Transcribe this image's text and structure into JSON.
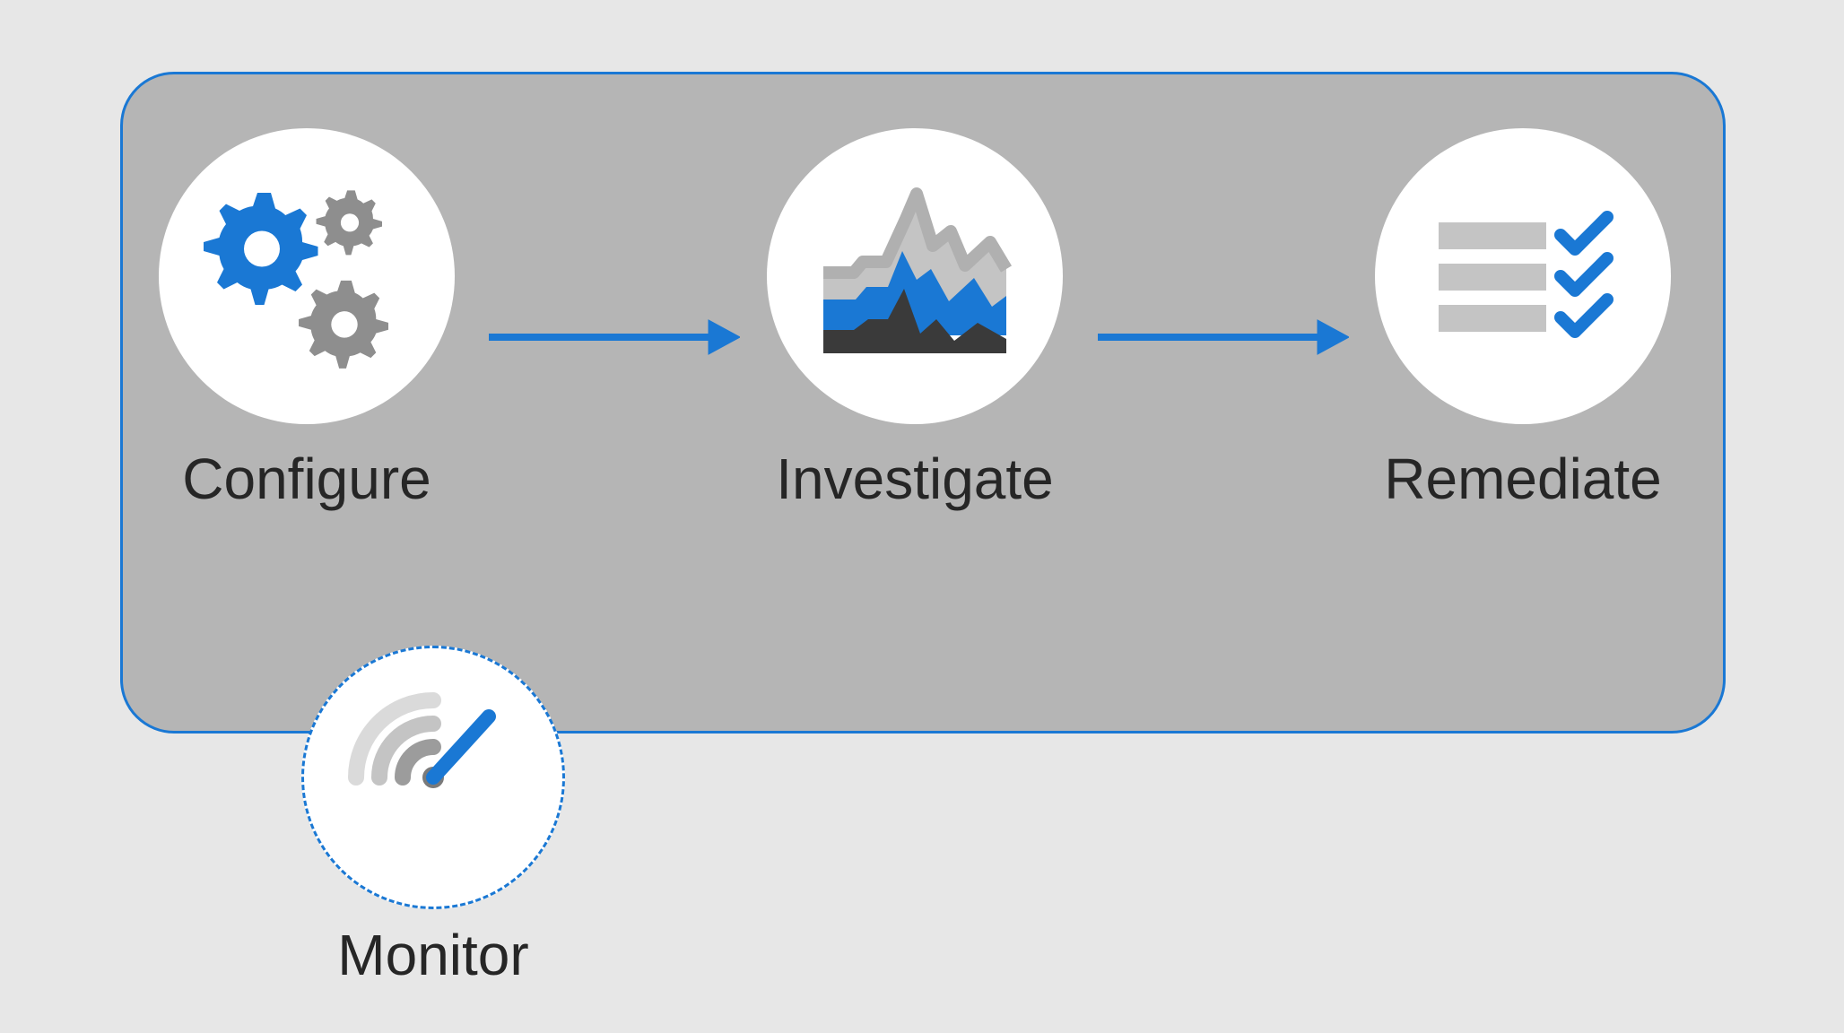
{
  "steps": [
    {
      "label": "Configure",
      "icon": "gears-icon"
    },
    {
      "label": "Investigate",
      "icon": "chart-icon"
    },
    {
      "label": "Remediate",
      "icon": "checklist-icon"
    }
  ],
  "monitor": {
    "label": "Monitor",
    "icon": "radar-icon"
  },
  "colors": {
    "accent": "#1A78D4",
    "gray": "#8E8E8E",
    "light_gray": "#C4C4C4",
    "dark": "#3A3A3A",
    "bg": "#E7E7E7",
    "container": "#B5B5B5"
  }
}
